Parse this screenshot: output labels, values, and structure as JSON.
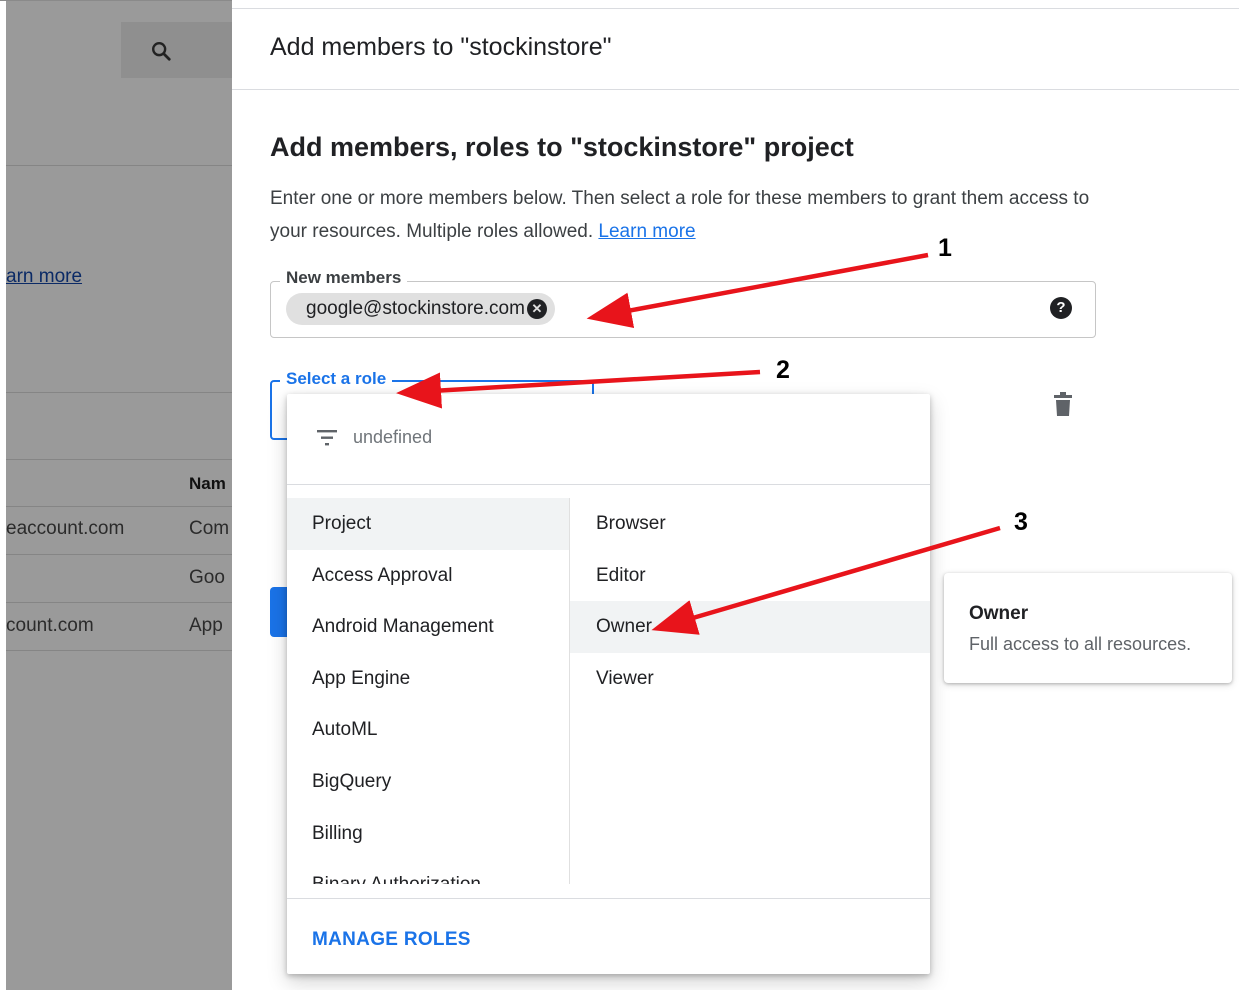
{
  "background": {
    "learn_more": "arn more",
    "table_header_name": "Nam",
    "rows": [
      {
        "col1": "eaccount.com",
        "col2": "Com"
      },
      {
        "col1": "",
        "col2": "Goo"
      },
      {
        "col1": "count.com",
        "col2": "App"
      }
    ]
  },
  "panel": {
    "title": "Add members to \"stockinstore\"",
    "section_title": "Add members, roles to \"stockinstore\" project",
    "description": "Enter one or more members below. Then select a role for these members to grant them access to your resources. Multiple roles allowed.",
    "learn_more": "Learn more",
    "members_label": "New members",
    "member_chip": "google@stockinstore.com",
    "role_label": "Select a role"
  },
  "dropdown": {
    "filter_text": "undefined",
    "categories": [
      "Project",
      "Access Approval",
      "Android Management",
      "App Engine",
      "AutoML",
      "BigQuery",
      "Billing",
      "Binary Authorization"
    ],
    "selected_category": "Project",
    "roles": [
      "Browser",
      "Editor",
      "Owner",
      "Viewer"
    ],
    "hovered_role": "Owner",
    "manage_roles": "MANAGE ROLES"
  },
  "info_card": {
    "title": "Owner",
    "description": "Full access to all resources."
  },
  "annotations": {
    "labels": [
      "1",
      "2",
      "3"
    ],
    "arrow_color": "#e8141b"
  }
}
